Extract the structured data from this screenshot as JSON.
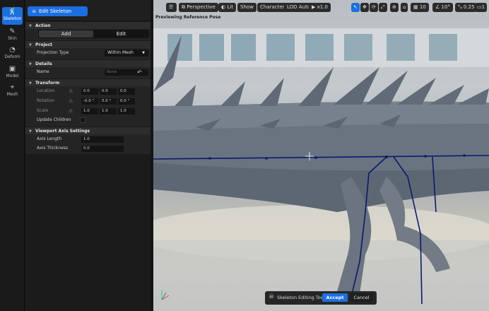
{
  "modes": [
    {
      "label": "Skeleton",
      "icon": "skeleton-icon",
      "glyph": "🕺",
      "active": true
    },
    {
      "label": "Skin",
      "icon": "brush-icon",
      "glyph": "✎",
      "active": false
    },
    {
      "label": "Deform",
      "icon": "deform-icon",
      "glyph": "◔",
      "active": false
    },
    {
      "label": "Model",
      "icon": "cube-icon",
      "glyph": "▣",
      "active": false
    },
    {
      "label": "Mesh",
      "icon": "mesh-icon",
      "glyph": "⌖",
      "active": false
    }
  ],
  "tool": {
    "button_label": "Edit Skeleton"
  },
  "sections": {
    "action": "Action",
    "project": "Project",
    "details": "Details",
    "transform": "Transform",
    "viewport_axis": "Viewport Axis Settings"
  },
  "action": {
    "add": "Add",
    "edit": "Edit",
    "selected": "Add"
  },
  "project": {
    "projection_label": "Projection Type",
    "projection_value": "Within Mesh"
  },
  "details": {
    "name_label": "Name",
    "name_placeholder": "None"
  },
  "transform": {
    "location_label": "Location",
    "location": [
      "0.0",
      "0.0",
      "0.0"
    ],
    "rotation_label": "Rotation",
    "rotation": [
      "-0.0 °",
      "0.0 °",
      "0.0 °"
    ],
    "scale_label": "Scale",
    "scale": [
      "1.0",
      "1.0",
      "1.0"
    ],
    "update_children_label": "Update Children",
    "update_children": false
  },
  "axis_settings": {
    "length_label": "Axis Length",
    "length": "1.0",
    "thickness_label": "Axis Thickness",
    "thickness": "0.0"
  },
  "viewport": {
    "perspective": "Perspective",
    "lit": "Lit",
    "show": "Show",
    "character": "Character",
    "lod": "LOD Auto",
    "speed": "x1.0",
    "grid_size": "10",
    "angle": "10°",
    "scale_snap": "0.25",
    "camera_speed": "1",
    "overlay_text": "Previewing Reference Pose"
  },
  "bottom_bar": {
    "label": "Skeleton Editing Tool",
    "accept": "Accept",
    "cancel": "Cancel"
  },
  "colors": {
    "accent": "#1c6fe0",
    "panel": "#242424",
    "bone": "#0a1a6e"
  }
}
